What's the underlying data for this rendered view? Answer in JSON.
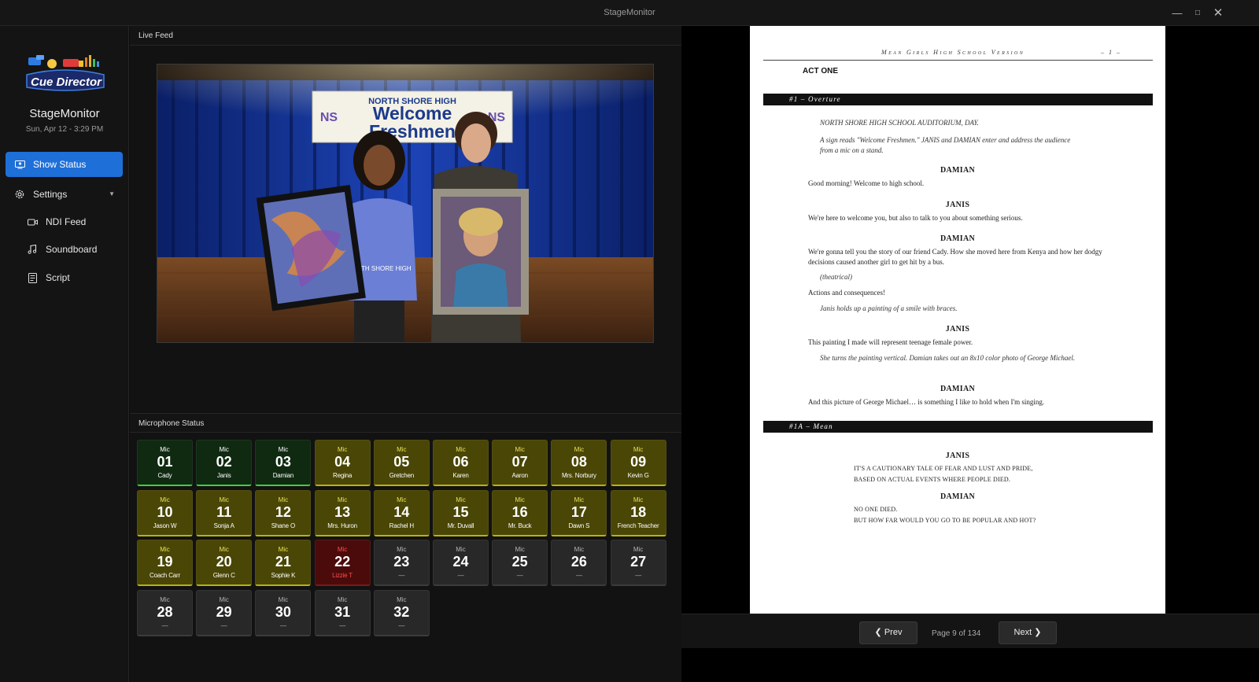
{
  "window": {
    "title": "StageMonitor"
  },
  "sidebar": {
    "logo_text": "Cue Director",
    "app_name": "StageMonitor",
    "datetime": "Sun, Apr 12  -  3:29 PM",
    "items": [
      {
        "label": "Show Status",
        "icon": "monitor-icon",
        "active": true
      },
      {
        "label": "Settings",
        "icon": "gear-icon"
      },
      {
        "label": "NDI Feed",
        "icon": "camera-icon"
      },
      {
        "label": "Soundboard",
        "icon": "music-note-icon"
      },
      {
        "label": "Script",
        "icon": "document-icon"
      }
    ]
  },
  "live_feed": {
    "header": "Live Feed",
    "sign_line1": "NORTH SHORE HIGH",
    "sign_line2": "Welcome",
    "sign_line3": "Freshmen",
    "badge": "NS",
    "shirt_text": "NORTH SHORE HIGH"
  },
  "microphones": {
    "header": "Microphone Status",
    "mic_label": "Mic",
    "mics": [
      {
        "num": "01",
        "name": "Cady",
        "status": "green"
      },
      {
        "num": "02",
        "name": "Janis",
        "status": "green"
      },
      {
        "num": "03",
        "name": "Damian",
        "status": "green"
      },
      {
        "num": "04",
        "name": "Regina",
        "status": "yellow"
      },
      {
        "num": "05",
        "name": "Gretchen",
        "status": "yellow"
      },
      {
        "num": "06",
        "name": "Karen",
        "status": "yellow"
      },
      {
        "num": "07",
        "name": "Aaron",
        "status": "yellow"
      },
      {
        "num": "08",
        "name": "Mrs. Norbury",
        "status": "yellow"
      },
      {
        "num": "09",
        "name": "Kevin G",
        "status": "yellow"
      },
      {
        "num": "10",
        "name": "Jason W",
        "status": "yellow"
      },
      {
        "num": "11",
        "name": "Sonja A",
        "status": "yellow"
      },
      {
        "num": "12",
        "name": "Shane O",
        "status": "yellow"
      },
      {
        "num": "13",
        "name": "Mrs. Huron",
        "status": "yellow"
      },
      {
        "num": "14",
        "name": "Rachel H",
        "status": "yellow"
      },
      {
        "num": "15",
        "name": "Mr. Duvall",
        "status": "yellow"
      },
      {
        "num": "16",
        "name": "Mr. Buck",
        "status": "yellow"
      },
      {
        "num": "17",
        "name": "Dawn S",
        "status": "yellow"
      },
      {
        "num": "18",
        "name": "French Teacher",
        "status": "yellow"
      },
      {
        "num": "19",
        "name": "Coach Carr",
        "status": "yellow"
      },
      {
        "num": "20",
        "name": "Glenn C",
        "status": "yellow"
      },
      {
        "num": "21",
        "name": "Sophie K",
        "status": "yellow"
      },
      {
        "num": "22",
        "name": "Lizzie T",
        "status": "red"
      },
      {
        "num": "23",
        "name": "—",
        "status": "gray"
      },
      {
        "num": "24",
        "name": "—",
        "status": "gray"
      },
      {
        "num": "25",
        "name": "—",
        "status": "gray"
      },
      {
        "num": "26",
        "name": "—",
        "status": "gray"
      },
      {
        "num": "27",
        "name": "—",
        "status": "gray"
      },
      {
        "num": "28",
        "name": "—",
        "status": "gray"
      },
      {
        "num": "29",
        "name": "—",
        "status": "gray"
      },
      {
        "num": "30",
        "name": "—",
        "status": "gray"
      },
      {
        "num": "31",
        "name": "—",
        "status": "gray"
      },
      {
        "num": "32",
        "name": "—",
        "status": "gray"
      }
    ]
  },
  "script": {
    "header": "Mean Girls High School Version",
    "page_marker": "– 1 –",
    "act": "ACT ONE",
    "section1": "#1 – Overture",
    "setting": "NORTH SHORE HIGH SCHOOL AUDITORIUM, DAY.",
    "stage_dir1": "A sign reads \"Welcome Freshmen.\" JANIS and DAMIAN enter and address the audience from a mic on a stand.",
    "char_damian": "DAMIAN",
    "char_janis": "JANIS",
    "line1": "Good morning! Welcome to high school.",
    "line2": "We're here to welcome you, but also to talk to you about something serious.",
    "line3": "We're gonna tell you the story of our friend Cady. How she moved here from Kenya and how her dodgy decisions caused another girl to get hit by a bus.",
    "paren": "(theatrical)",
    "line4": "Actions and consequences!",
    "stage_dir2": "Janis holds up a painting of a smile with braces.",
    "line5": "This painting I made will represent teenage female power.",
    "stage_dir3": "She turns the painting vertical. Damian takes out an 8x10 color photo of George Michael.",
    "line6": "And this picture of George Michael… is something I like to hold when I'm singing.",
    "section2": "#1A – Mean",
    "lyric1": "IT'S A CAUTIONARY TALE OF FEAR AND LUST AND PRIDE,",
    "lyric2": "BASED ON ACTUAL EVENTS WHERE PEOPLE DIED.",
    "lyric3": "NO ONE DIED.",
    "lyric4": "BUT HOW FAR WOULD YOU GO TO BE POPULAR AND HOT?"
  },
  "pager": {
    "prev": "Prev",
    "next": "Next",
    "info": "Page 9 of 134"
  },
  "colors": {
    "accent": "#1f6fd8",
    "mic_green": "#3fcf3f",
    "mic_yellow": "#b8b214",
    "mic_red": "#ff4d4d"
  }
}
